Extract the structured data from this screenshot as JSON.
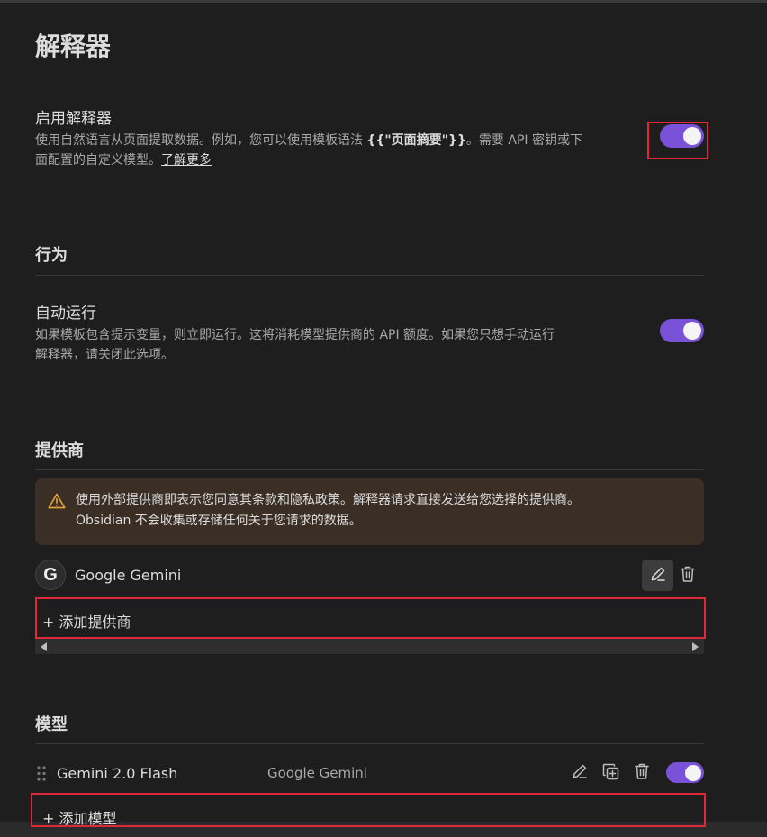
{
  "page": {
    "title": "解释器"
  },
  "interpreter": {
    "name": "启用解释器",
    "desc_line1_pre": "使用自然语言从页面提取数据。例如，您可以使用模板语法 ",
    "desc_template": "{{\"页面摘要\"}}",
    "desc_line1_post": "。需要 API 密钥或下",
    "desc_line2": "面配置的自定义模型。",
    "learn_more": "了解更多",
    "enabled": true
  },
  "behavior": {
    "heading": "行为",
    "auto_run": {
      "name": "自动运行",
      "desc_line1": "如果模板包含提示变量，则立即运行。这将消耗模型提供商的 API 额度。如果您只想手动运行",
      "desc_line2": "解释器，请关闭此选项。",
      "enabled": true
    }
  },
  "providers": {
    "heading": "提供商",
    "notice_line1": "使用外部提供商即表示您同意其条款和隐私政策。解释器请求直接发送给您选择的提供商。",
    "notice_line2": "Obsidian 不会收集或存储任何关于您请求的数据。",
    "items": [
      {
        "logo_letter": "G",
        "name": "Google Gemini"
      }
    ],
    "add_label": "+ 添加提供商"
  },
  "models": {
    "heading": "模型",
    "items": [
      {
        "name": "Gemini 2.0 Flash",
        "provider": "Google Gemini",
        "enabled": true
      }
    ],
    "add_label": "+ 添加模型"
  },
  "icons": {
    "edit": "pencil-icon",
    "delete": "trash-icon",
    "duplicate": "copy-plus-icon",
    "warning": "alert-triangle-icon",
    "drag": "grip-vertical-icon"
  },
  "colors": {
    "background": "#1e1e1e",
    "accent": "#7a52d9",
    "warning": "#e0a040",
    "callout_bg": "#3b2f25",
    "highlight": "#e0283a"
  }
}
